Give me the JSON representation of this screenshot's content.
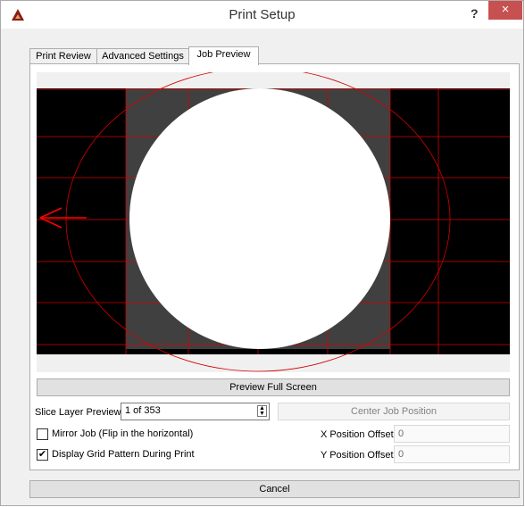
{
  "window": {
    "title": "Print Setup",
    "help_label": "?",
    "close_label": "×"
  },
  "tabs": [
    {
      "label": "Print Review",
      "active": false
    },
    {
      "label": "Advanced Settings",
      "active": false
    },
    {
      "label": "Job Preview",
      "active": true
    }
  ],
  "preview": {
    "background": "#000000",
    "grid_color": "#d40000",
    "layer_color": "#ffffff",
    "build_area_color": "#404040",
    "arrow_color": "#ff0000",
    "arrow_icon": "left-arrow"
  },
  "buttons": {
    "preview_full_screen": "Preview Full Screen",
    "center_job_position": "Center Job Position",
    "cancel": "Cancel"
  },
  "slice_layer": {
    "label": "Slice Layer Preview:",
    "value": "1 of 353",
    "current": 1,
    "total": 353
  },
  "options": {
    "mirror_job": {
      "label": "Mirror Job (Flip in the horizontal)",
      "checked": false
    },
    "display_grid": {
      "label": "Display Grid Pattern During Print",
      "checked": true
    }
  },
  "offsets": {
    "x_label": "X Position Offset:",
    "x_value": "0",
    "y_label": "Y Position Offset:",
    "y_value": "0"
  }
}
